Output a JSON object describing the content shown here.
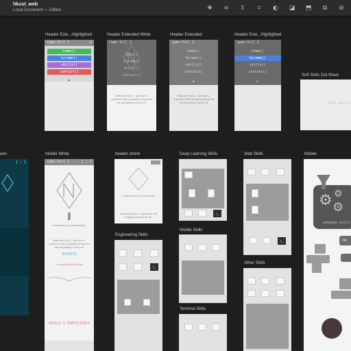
{
  "window": {
    "title": "hkust_web",
    "subtitle": "Local Document — Edited",
    "toolbar_icons": [
      "component-icon",
      "align-icon",
      "distribute-icon",
      "transform-icon",
      "mask-icon",
      "boolean-icon",
      "export-icon",
      "overflow-icon",
      "link-icon"
    ]
  },
  "frames": {
    "header_ext_highlighted_1": {
      "label": "Header Exte...Highlighted",
      "header_text": "ryan.fc() {",
      "header_btn": "x",
      "menu": [
        "home()",
        "hireme()",
        "skills()",
        "contact()"
      ]
    },
    "header_extended_white": {
      "label": "Header Extended White",
      "header_text": "ryan.fc() {",
      "menu": [
        "home()",
        "hireme()",
        "skills()",
        "contact()"
      ],
      "intro_text": "Today ryan.fc() is... ryan.fc() is... experience with navigating through the site and getting to know me."
    },
    "header_extended": {
      "label": "Header Extended",
      "header_text": "ryan.fc() {",
      "menu": [
        "home()",
        "hireme()",
        "skills()",
        "contact()"
      ],
      "intro_text": "Today ryan.fc() is... ryan.fc() is... experience with navigating through the site and getting to know me."
    },
    "header_ext_highlighted_2": {
      "label": "Header Exte...Highlighted",
      "header_text": "ryan.fc() {",
      "menu": [
        "home()",
        "hireme()",
        "skills()",
        "contact()"
      ]
    },
    "soft_skills": {
      "label": "Soft Skills Dot Wave",
      "text": "soft skills"
    },
    "screen_left": {
      "label": "een",
      "header_btn": "[ : ]"
    },
    "mobile_white": {
      "label": "Mobile White",
      "header_text": "ryan.fc() {",
      "header_btn": "[ : ]",
      "welcome": "In welcome to my personal site",
      "intro": "Today ryan.fc() is... ryan.fc() is... experience with navigating through the site and getting to know me.",
      "section_1": "BIODATA",
      "pink_note_1": "I'm a passionate developer",
      "section_2": "SKILLS & PROFICIENCY"
    },
    "header_shrink": {
      "label": "header shrink",
      "welcome": "In welcome to my personal site",
      "intro": "Today ryan.fc() is... experience with navigating through the site."
    },
    "engineering_skills": {
      "label": "Engineering Skills"
    },
    "deep_learning_skills": {
      "label": "Deep Learning Skills"
    },
    "mobile_skills": {
      "label": "Mobile Skills"
    },
    "terminal_skills": {
      "label": "Terminal Skills"
    },
    "web_skills": {
      "label": "Web Skills"
    },
    "other_skills": {
      "label": "Other Skills"
    },
    "mobile_illus": {
      "label": "Mobile",
      "site_text": "webpage.build",
      "bubble": "hel"
    }
  }
}
